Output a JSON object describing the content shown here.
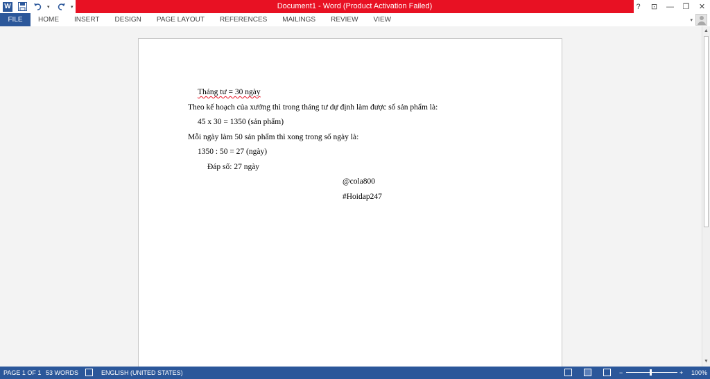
{
  "window": {
    "title": "Document1 - Word (Product Activation Failed)",
    "controls": [
      "?",
      "⊡",
      "—",
      "❐",
      "✕"
    ]
  },
  "qat": {
    "app_icon": "W",
    "icons": [
      "word-icon",
      "save-icon",
      "undo-icon",
      "redo-icon",
      "customize-qat-icon"
    ]
  },
  "ribbon": {
    "file_label": "FILE",
    "tabs": [
      "HOME",
      "INSERT",
      "DESIGN",
      "PAGE LAYOUT",
      "REFERENCES",
      "MAILINGS",
      "REVIEW",
      "VIEW"
    ]
  },
  "document": {
    "lines": [
      "Tháng tư = 30 ngày",
      "Theo kế hoạch của xưởng thì trong tháng tư dự định làm được số sản phẩm là:",
      "45 x 30 = 1350 (sản phẩm)",
      "Mỗi ngày làm 50 sản phẩm thì xong trong số ngày là:",
      "1350 : 50 = 27 (ngày)",
      "Đáp số: 27 ngày",
      "@cola800",
      "#Hoidap247"
    ]
  },
  "status": {
    "page": "PAGE 1 OF 1",
    "words": "53 WORDS",
    "language": "ENGLISH (UNITED STATES)",
    "zoom": "100%",
    "zoom_minus": "−",
    "zoom_plus": "+"
  },
  "colors": {
    "brand": "#2b579a",
    "title_error": "#e81123"
  }
}
